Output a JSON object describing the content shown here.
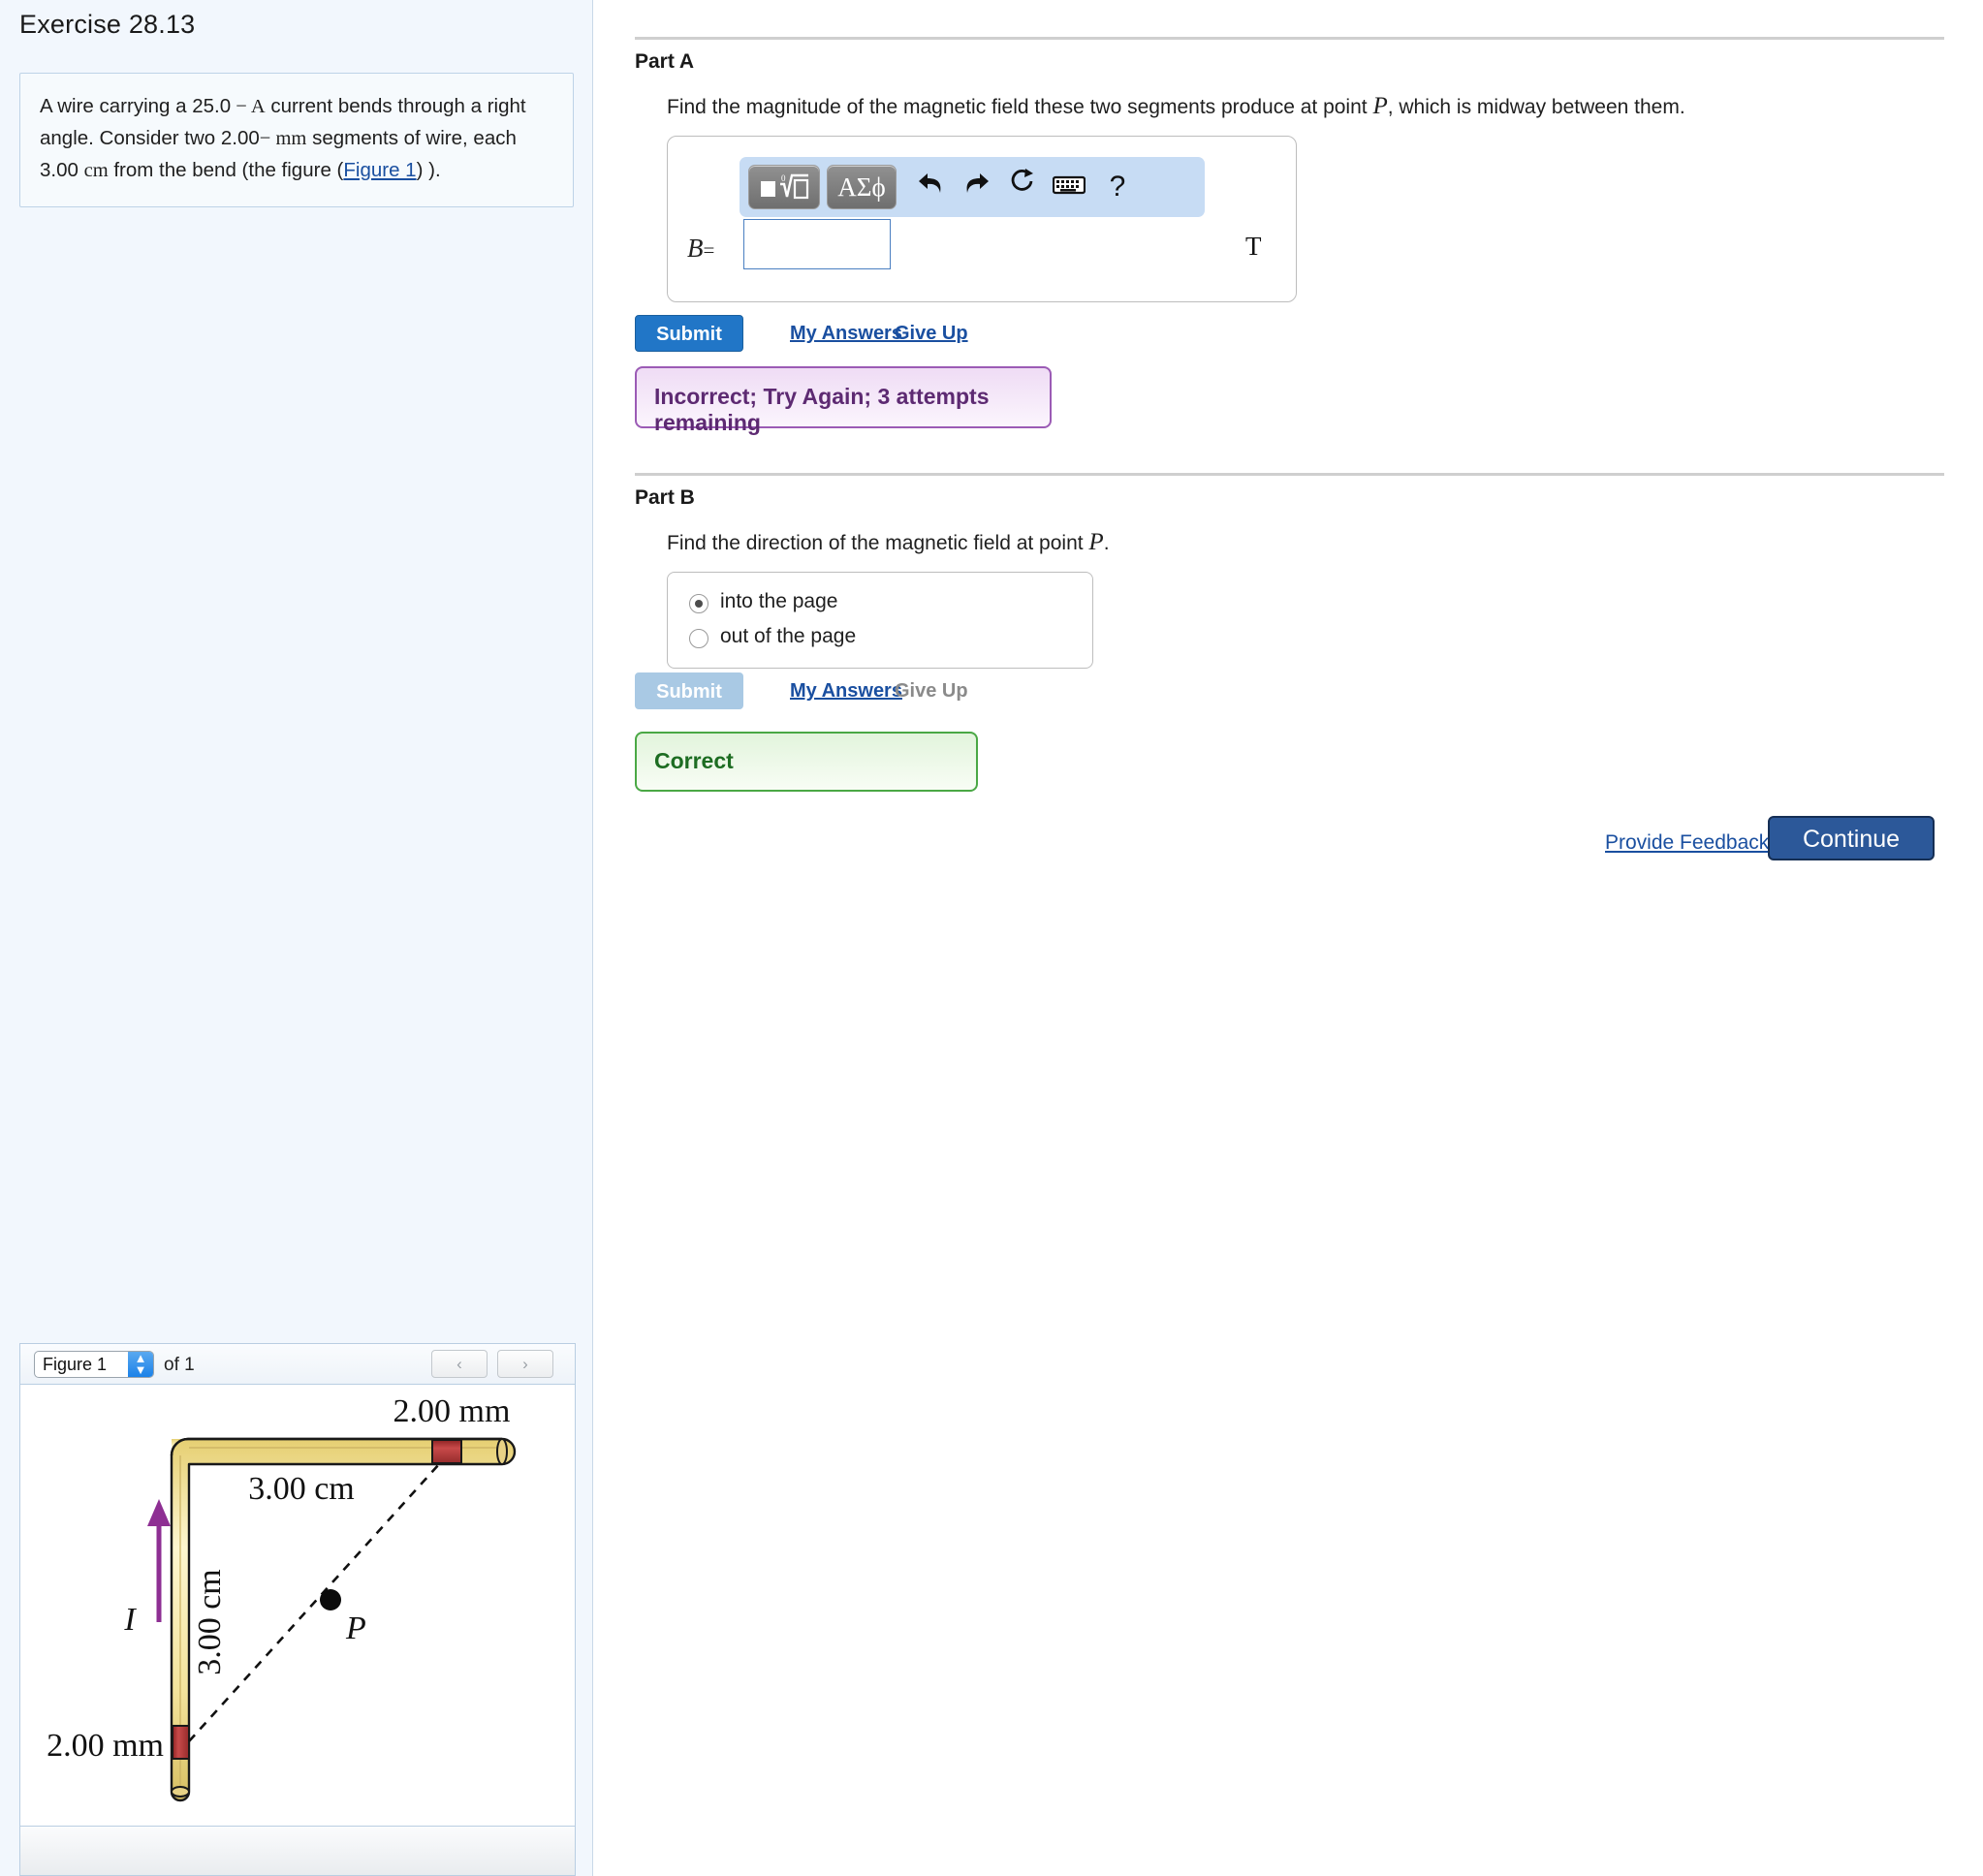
{
  "exercise": {
    "title": "Exercise 28.13",
    "problem_prefix": "A wire carrying a 25.0",
    "problem_dash1": " − ",
    "problem_unit1": "A",
    "problem_mid": " current bends through a right angle. Consider two 2.00",
    "problem_dash2": "− ",
    "problem_unit2": "mm",
    "problem_mid2": " segments of wire, each 3.00 ",
    "problem_unit3": "cm",
    "problem_tail_open": " from the bend (the figure (",
    "figure_link": "Figure 1",
    "problem_tail_close": ") )."
  },
  "part_a": {
    "label": "Part A",
    "question_before": "Find the magnitude of the magnetic field these two segments produce at point ",
    "question_symbol": "P",
    "question_after": ", which is midway between them.",
    "math_toolbar": {
      "template_icon": "template-button",
      "greek_label": "ΑΣϕ",
      "undo_icon": "↩",
      "redo_icon": "↪",
      "reset_icon": "⟳",
      "keyboard_icon": "keyboard-icon",
      "help_icon": "?"
    },
    "variable": "B",
    "equals": "=",
    "input_value": "",
    "input_placeholder": "",
    "units": "T",
    "submit_label": "Submit",
    "my_answers_label": "My Answers",
    "give_up_label": "Give Up",
    "feedback": "Incorrect; Try Again; 3 attempts remaining"
  },
  "part_b": {
    "label": "Part B",
    "question_before": "Find the direction of the magnetic field at point ",
    "question_symbol": "P",
    "question_after": ".",
    "options": [
      {
        "label": "into the page",
        "selected": true
      },
      {
        "label": "out of the page",
        "selected": false
      }
    ],
    "submit_label": "Submit",
    "my_answers_label": "My Answers",
    "give_up_label": "Give Up",
    "feedback": "Correct"
  },
  "footer": {
    "provide_feedback_label": "Provide Feedback",
    "continue_label": "Continue"
  },
  "figure_panel": {
    "selected_figure": "Figure 1",
    "of_label": "of 1",
    "prev_icon": "‹",
    "next_icon": "›",
    "dropdown_icon": "chevron-updown-icon",
    "diagram": {
      "label_top": "2.00 mm",
      "label_horizontal": "3.00 cm",
      "label_vertical": "3.00 cm",
      "label_bottom": "2.00 mm",
      "current_label": "I",
      "point_label": "P",
      "wire_color": "#f5e6a8",
      "segment_color": "#b53434",
      "arrow_color": "#8e2f93"
    }
  },
  "colors": {
    "accent_blue": "#2176c7",
    "link_blue": "#1a4fa0",
    "incorrect_purple": "#5d2a72",
    "correct_green": "#1d6d22",
    "toolbar_blue": "#c7dcf4",
    "panel_bg": "#f2f7fd"
  }
}
